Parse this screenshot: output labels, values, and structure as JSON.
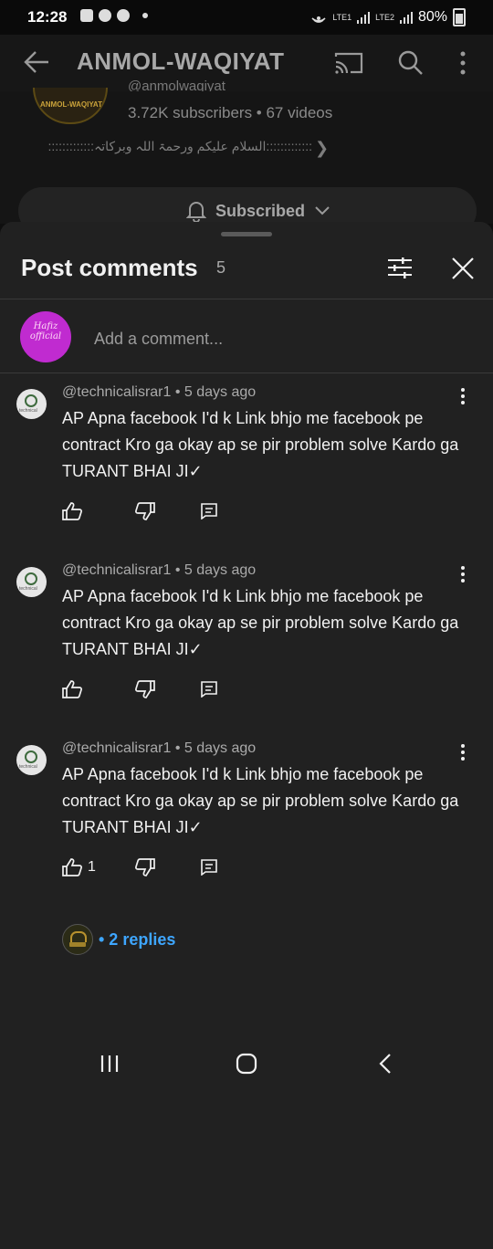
{
  "status_bar": {
    "time": "12:28",
    "sim1": "LTE1",
    "sim2": "LTE2",
    "battery": "80%"
  },
  "channel": {
    "title": "ANMOL-WAQIYAT",
    "logo_text": "ANMOL-WAQIYAT",
    "handle": "@anmolwaqiyat",
    "subscribers": "3.72K subscribers • 67 videos",
    "description": ":::::::::::::السلام علیکم ورحمۃ اللہ وبرکاتہ:::::::::::::",
    "subscribe_label": "Subscribed"
  },
  "sheet": {
    "title": "Post comments",
    "count": "5",
    "add_comment_placeholder": "Add a comment...",
    "user_avatar_text": "Hafiz official"
  },
  "comments": [
    {
      "author": "@technicalisrar1",
      "age": "5 days ago",
      "text": "AP Apna facebook I'd k Link bhjo me facebook pe contract Kro ga okay ap se pir problem solve Kardo ga TURANT BHAI JI✓",
      "likes": ""
    },
    {
      "author": "@technicalisrar1",
      "age": "5 days ago",
      "text": "AP Apna facebook I'd k Link bhjo me facebook pe contract Kro ga okay ap se pir problem solve Kardo ga TURANT BHAI JI✓",
      "likes": ""
    },
    {
      "author": "@technicalisrar1",
      "age": "5 days ago",
      "text": "AP Apna facebook I'd k Link bhjo me facebook pe contract Kro ga okay ap se pir problem solve Kardo ga TURANT BHAI JI✓",
      "likes": "1"
    }
  ],
  "replies": {
    "label": "• 2 replies"
  },
  "colors": {
    "background": "#0f0f0f",
    "sheet": "#212121",
    "link": "#3ea6ff",
    "secondary_text": "#aaaaaa"
  }
}
